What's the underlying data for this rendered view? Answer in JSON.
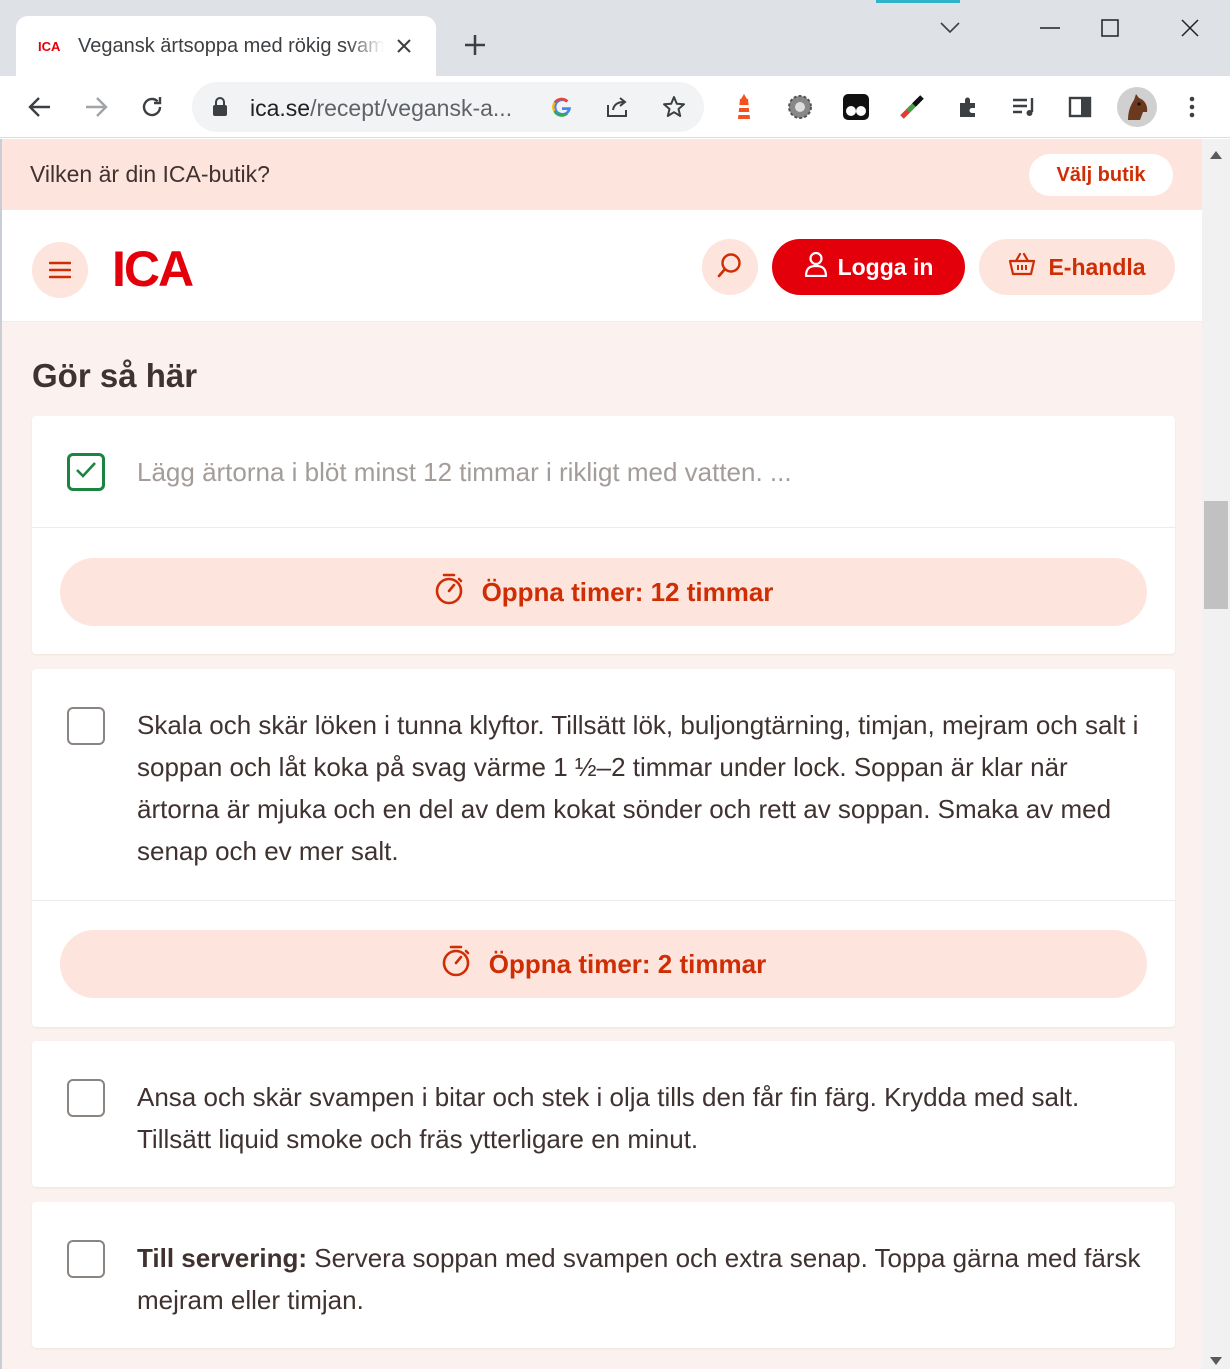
{
  "browser": {
    "tab_title": "Vegansk ärtsoppa med rökig svamp",
    "url_host": "ica.se",
    "url_path": "/recept/vegansk-a..."
  },
  "store_bar": {
    "question": "Vilken är din ICA-butik?",
    "button": "Välj butik"
  },
  "header": {
    "logo": "ICA",
    "login": "Logga in",
    "ehandla": "E-handla"
  },
  "section": {
    "title": "Gör så här"
  },
  "steps": [
    {
      "checked": true,
      "text": "Lägg ärtorna i blöt minst 12 timmar i rikligt med vatten. ...",
      "timer": "Öppna timer: 12 timmar"
    },
    {
      "checked": false,
      "text": "Skala och skär löken i tunna klyftor. Tillsätt lök, buljongtärning, timjan, mejram och salt i soppan och låt koka på svag värme 1 ½–2 timmar under lock. Soppan är klar när ärtorna är mjuka och en del av dem kokat sönder och rett av soppan. Smaka av med senap och ev mer salt.",
      "timer": "Öppna timer: 2 timmar"
    },
    {
      "checked": false,
      "text": "Ansa och skär svampen i bitar och stek i olja tills den får fin färg. Krydda med salt. Tillsätt liquid smoke och fräs ytterligare en minut."
    },
    {
      "checked": false,
      "bold": "Till servering:",
      "text": " Servera soppan med svampen och extra senap. Toppa gärna med färsk mejram eller timjan."
    }
  ],
  "colors": {
    "ica_red": "#e3000b",
    "accent_text": "#cf2e05",
    "soft_pink": "#fde4dc",
    "page_bg": "#fbf1ee",
    "check_green": "#1c8440"
  }
}
